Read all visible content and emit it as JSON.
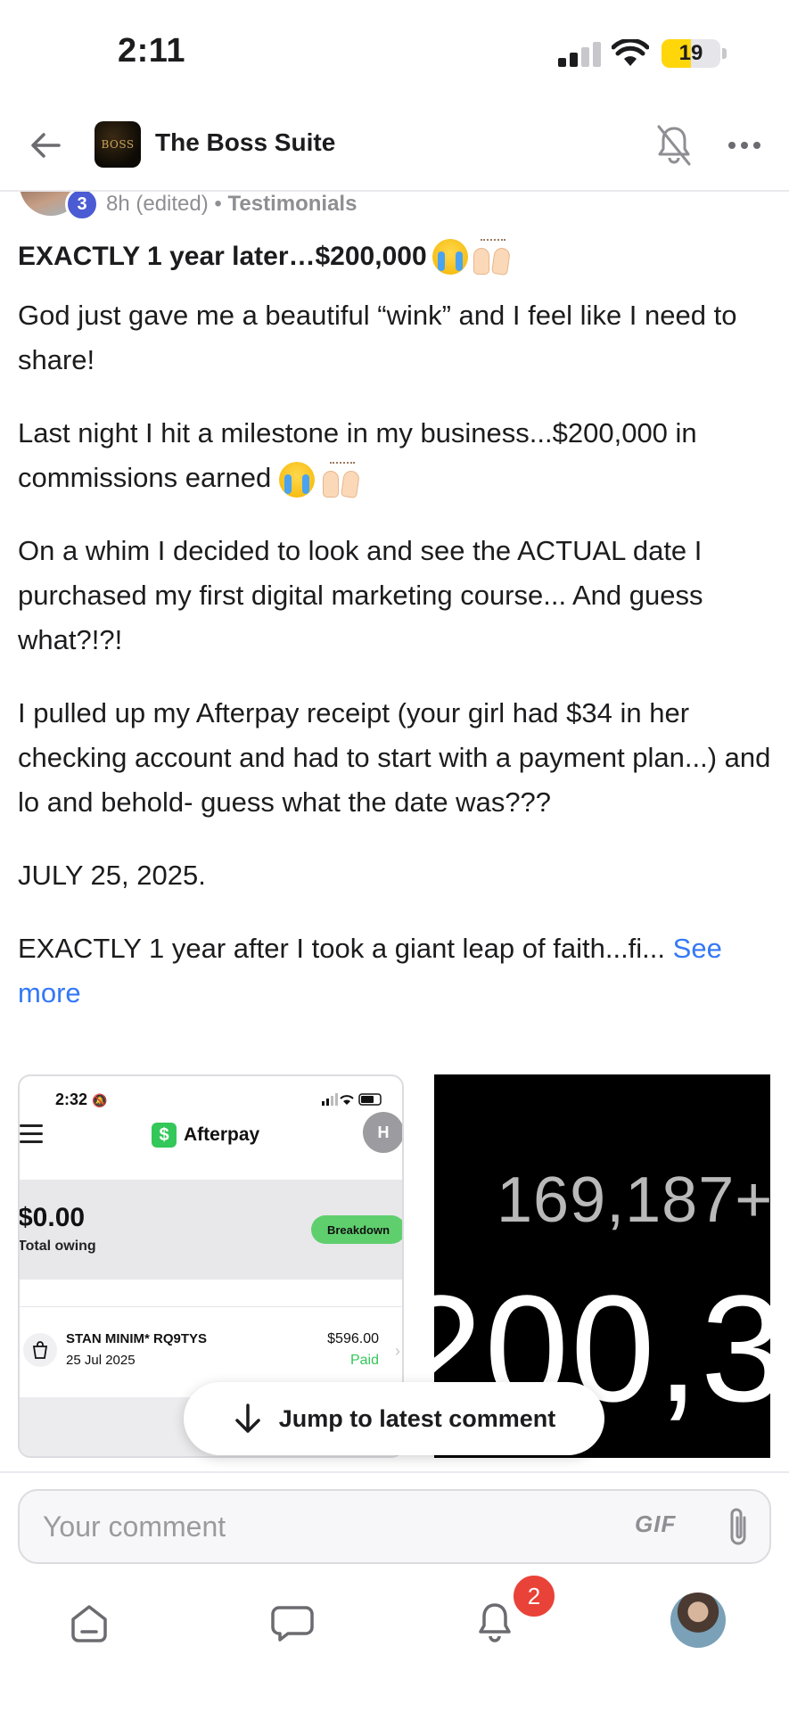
{
  "status_bar": {
    "time": "2:11",
    "battery_level": "19",
    "battery_fraction": 0.19
  },
  "header": {
    "back_icon": "arrow-left-icon",
    "group_name": "The Boss Suite",
    "group_logo_text": "BOSS",
    "notifications_icon": "bell-off-icon",
    "more_icon": "more-horizontal-icon"
  },
  "post": {
    "author_level": "3",
    "time": "8h (edited)",
    "separator": "•",
    "category": "Testimonials",
    "title": "EXACTLY 1 year later…$200,000",
    "paragraphs": [
      "God just gave me a beautiful “wink” and I feel like I need to share!",
      "Last night I hit a milestone in my business...$200,000 in commissions earned",
      "On a whim I decided to look and see the ACTUAL date I purchased my first digital marketing course... And guess what?!?!",
      "I pulled up my Afterpay receipt (your girl had $34 in her checking account and had to start with a payment plan...) and lo and behold- guess what the date was???",
      "JULY 25, 2025.",
      "EXACTLY 1 year after I took a giant leap of faith...fi..."
    ],
    "see_more": "See more"
  },
  "attachments": {
    "afterpay": {
      "status_time": "2:32",
      "brand": "Afterpay",
      "brand_mark": "$",
      "user_initial": "H",
      "total_amount": "$0.00",
      "total_label": "Total owing",
      "breakdown_label": "Breakdown",
      "merchant": "STAN MINIM* RQ9TYS",
      "date": "25 Jul 2025",
      "price": "$596.00",
      "status": "Paid"
    },
    "counter": {
      "top_value": "169,187+",
      "big_value": "200,3"
    }
  },
  "jump_to_latest": "Jump to latest comment",
  "composer": {
    "placeholder": "Your comment",
    "gif_label": "GIF",
    "attach_icon": "paperclip-icon"
  },
  "tabbar": {
    "notifications_count": "2"
  },
  "colors": {
    "accent_link": "#3478f6",
    "badge_red": "#e94238",
    "level_badge": "#4a5bd4",
    "afterpay_green": "#34c759"
  }
}
